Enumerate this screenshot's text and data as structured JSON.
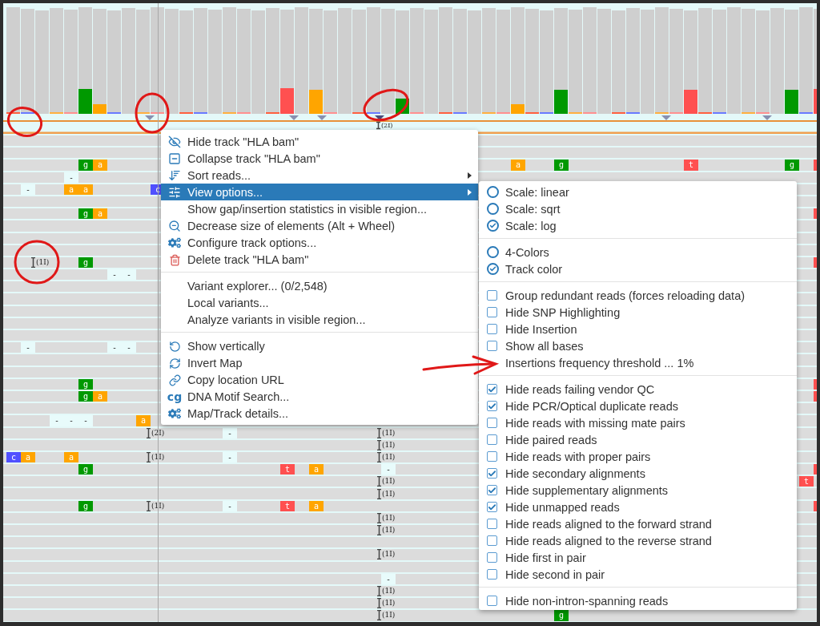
{
  "coverage": {
    "insertion_label": "(2I)"
  },
  "reads": {
    "rows": [
      {
        "marks": []
      },
      {
        "marks": []
      },
      {
        "marks": [
          {
            "kind": "base",
            "text": "g",
            "color": "#009900"
          },
          {
            "kind": "base",
            "text": "a",
            "color": "#ffa500"
          },
          {
            "kind": "base",
            "text": "a",
            "color": "#ffa500"
          },
          {
            "kind": "base",
            "text": "g",
            "color": "#009900"
          },
          {
            "kind": "base",
            "text": "t",
            "color": "#ff5050"
          },
          {
            "kind": "base",
            "text": "g",
            "color": "#009900"
          },
          {
            "kind": "edge",
            "color": "#ff5050"
          }
        ]
      },
      {
        "marks": [
          {
            "kind": "gap",
            "text": "-"
          }
        ]
      },
      {
        "marks": [
          {
            "kind": "gap",
            "text": "-"
          },
          {
            "kind": "base",
            "text": "a",
            "color": "#ffa500"
          },
          {
            "kind": "base",
            "text": "a",
            "color": "#ffa500"
          },
          {
            "kind": "base",
            "text": "c",
            "color": "#5050ff"
          }
        ]
      },
      {
        "marks": []
      },
      {
        "marks": [
          {
            "kind": "base",
            "text": "g",
            "color": "#009900"
          },
          {
            "kind": "base",
            "text": "a",
            "color": "#ffa500"
          },
          {
            "kind": "edge",
            "color": "#ff5050"
          }
        ]
      },
      {
        "marks": []
      },
      {
        "marks": []
      },
      {
        "marks": []
      },
      {
        "marks": [
          {
            "kind": "insertion",
            "text": "(1I)"
          },
          {
            "kind": "base",
            "text": "g",
            "color": "#009900"
          },
          {
            "kind": "edge",
            "color": "#ff5050"
          }
        ]
      },
      {
        "marks": [
          {
            "kind": "gap",
            "text": "-"
          },
          {
            "kind": "gap",
            "text": "-"
          }
        ]
      },
      {
        "marks": []
      },
      {
        "marks": []
      },
      {
        "marks": []
      },
      {
        "marks": []
      },
      {
        "marks": []
      },
      {
        "marks": [
          {
            "kind": "gap",
            "text": "-"
          },
          {
            "kind": "gap",
            "text": "-"
          },
          {
            "kind": "gap",
            "text": "-"
          }
        ]
      },
      {
        "marks": []
      },
      {
        "marks": []
      },
      {
        "marks": [
          {
            "kind": "base",
            "text": "g",
            "color": "#009900"
          },
          {
            "kind": "edge",
            "color": "#ff5050"
          }
        ]
      },
      {
        "marks": [
          {
            "kind": "base",
            "text": "g",
            "color": "#009900"
          },
          {
            "kind": "base",
            "text": "a",
            "color": "#ffa500"
          },
          {
            "kind": "edge",
            "color": "#ff5050"
          }
        ]
      },
      {
        "marks": []
      },
      {
        "marks": [
          {
            "kind": "gap",
            "text": "-"
          },
          {
            "kind": "gap",
            "text": "-"
          },
          {
            "kind": "gap",
            "text": "-"
          },
          {
            "kind": "base",
            "text": "a",
            "color": "#ffa500"
          }
        ]
      },
      {
        "marks": [
          {
            "kind": "insertion",
            "text": "(2I)"
          },
          {
            "kind": "gap",
            "text": "-"
          },
          {
            "kind": "insertion",
            "text": "(1I)"
          }
        ]
      },
      {
        "marks": [
          {
            "kind": "insertion",
            "text": "(1I)"
          }
        ]
      },
      {
        "marks": [
          {
            "kind": "base",
            "text": "c",
            "color": "#5050ff"
          },
          {
            "kind": "base",
            "text": "a",
            "color": "#ffa500"
          },
          {
            "kind": "base",
            "text": "a",
            "color": "#ffa500"
          },
          {
            "kind": "insertion",
            "text": "(1I)"
          },
          {
            "kind": "gap",
            "text": "-"
          },
          {
            "kind": "insertion",
            "text": "(1I)"
          }
        ]
      },
      {
        "marks": [
          {
            "kind": "base",
            "text": "g",
            "color": "#009900"
          },
          {
            "kind": "base",
            "text": "t",
            "color": "#ff5050"
          },
          {
            "kind": "base",
            "text": "a",
            "color": "#ffa500"
          },
          {
            "kind": "gap",
            "text": "-"
          },
          {
            "kind": "edge",
            "color": "#ff5050"
          }
        ]
      },
      {
        "marks": [
          {
            "kind": "insertion",
            "text": "(1I)"
          },
          {
            "kind": "base",
            "text": "t",
            "color": "#ff5050"
          }
        ]
      },
      {
        "marks": [
          {
            "kind": "insertion",
            "text": "(1I)"
          }
        ]
      },
      {
        "marks": [
          {
            "kind": "base",
            "text": "g",
            "color": "#009900"
          },
          {
            "kind": "insertion",
            "text": "(1I)"
          },
          {
            "kind": "gap",
            "text": "-"
          },
          {
            "kind": "base",
            "text": "t",
            "color": "#ff5050"
          },
          {
            "kind": "base",
            "text": "a",
            "color": "#ffa500"
          },
          {
            "kind": "edge",
            "color": "#ff5050"
          }
        ]
      },
      {
        "marks": [
          {
            "kind": "insertion",
            "text": "(1I)"
          }
        ]
      },
      {
        "marks": [
          {
            "kind": "insertion",
            "text": "(1I)"
          }
        ]
      },
      {
        "marks": []
      },
      {
        "marks": [
          {
            "kind": "insertion",
            "text": "(1I)"
          }
        ]
      },
      {
        "marks": []
      },
      {
        "marks": [
          {
            "kind": "gap",
            "text": "-"
          }
        ]
      },
      {
        "marks": [
          {
            "kind": "insertion",
            "text": "(1I)"
          }
        ]
      },
      {
        "marks": [
          {
            "kind": "insertion",
            "text": "(1I)"
          }
        ]
      },
      {
        "marks": [
          {
            "kind": "insertion",
            "text": "(1I)"
          },
          {
            "kind": "base",
            "text": "g",
            "color": "#009900"
          }
        ]
      }
    ]
  },
  "context_menu": {
    "groups": [
      [
        {
          "label": "Hide track \"HLA bam\"",
          "selected": false,
          "submenu": false
        },
        {
          "label": "Collapse track \"HLA bam\"",
          "selected": false,
          "submenu": false
        },
        {
          "label": "Sort reads...",
          "selected": false,
          "submenu": true
        },
        {
          "label": "View options...",
          "selected": true,
          "submenu": true
        },
        {
          "label": "Show gap/insertion statistics in visible region...",
          "selected": false,
          "submenu": false
        },
        {
          "label": "Decrease size of elements (Alt + Wheel)",
          "selected": false,
          "submenu": false
        },
        {
          "label": "Configure track options...",
          "selected": false,
          "submenu": false
        },
        {
          "label": "Delete track \"HLA bam\"",
          "selected": false,
          "submenu": false
        }
      ],
      [
        {
          "label": "Variant explorer... (0/2,548)",
          "selected": false,
          "submenu": false
        },
        {
          "label": "Local variants...",
          "selected": false,
          "submenu": false
        },
        {
          "label": "Analyze variants in visible region...",
          "selected": false,
          "submenu": false
        }
      ],
      [
        {
          "label": "Show vertically",
          "selected": false,
          "submenu": false
        },
        {
          "label": "Invert Map",
          "selected": false,
          "submenu": false
        },
        {
          "label": "Copy location URL",
          "selected": false,
          "submenu": false
        },
        {
          "label": "DNA Motif Search...",
          "icon_text": "cg",
          "selected": false,
          "submenu": false
        },
        {
          "label": "Map/Track details...",
          "selected": false,
          "submenu": false
        }
      ]
    ]
  },
  "view_options_menu": {
    "groups": [
      [
        {
          "kind": "radio",
          "label": "Scale: linear",
          "checked": false
        },
        {
          "kind": "radio",
          "label": "Scale: sqrt",
          "checked": false
        },
        {
          "kind": "radio",
          "label": "Scale: log",
          "checked": true
        }
      ],
      [
        {
          "kind": "radio",
          "label": "4-Colors",
          "checked": false
        },
        {
          "kind": "radio",
          "label": "Track color",
          "checked": true
        }
      ],
      [
        {
          "kind": "checkbox",
          "label": "Group redundant reads (forces reloading data)",
          "checked": false
        },
        {
          "kind": "checkbox",
          "label": "Hide SNP Highlighting",
          "checked": false
        },
        {
          "kind": "checkbox",
          "label": "Hide Insertion",
          "checked": false
        },
        {
          "kind": "checkbox",
          "label": "Show all bases",
          "checked": false
        },
        {
          "kind": "action",
          "label": "Insertions frequency threshold ... 1%"
        }
      ],
      [
        {
          "kind": "checkbox",
          "label": "Hide reads failing vendor QC",
          "checked": true
        },
        {
          "kind": "checkbox",
          "label": "Hide PCR/Optical duplicate reads",
          "checked": true
        },
        {
          "kind": "checkbox",
          "label": "Hide reads with missing mate pairs",
          "checked": false
        },
        {
          "kind": "checkbox",
          "label": "Hide paired reads",
          "checked": false
        },
        {
          "kind": "checkbox",
          "label": "Hide reads with proper pairs",
          "checked": false
        },
        {
          "kind": "checkbox",
          "label": "Hide secondary alignments",
          "checked": true
        },
        {
          "kind": "checkbox",
          "label": "Hide supplementary alignments",
          "checked": true
        },
        {
          "kind": "checkbox",
          "label": "Hide unmapped reads",
          "checked": true
        },
        {
          "kind": "checkbox",
          "label": "Hide reads aligned to the forward strand",
          "checked": false
        },
        {
          "kind": "checkbox",
          "label": "Hide reads aligned to the reverse strand",
          "checked": false
        },
        {
          "kind": "checkbox",
          "label": "Hide first in pair",
          "checked": false
        },
        {
          "kind": "checkbox",
          "label": "Hide second in pair",
          "checked": false
        }
      ],
      [
        {
          "kind": "checkbox",
          "label": "Hide non-intron-spanning reads",
          "checked": false
        }
      ]
    ]
  }
}
